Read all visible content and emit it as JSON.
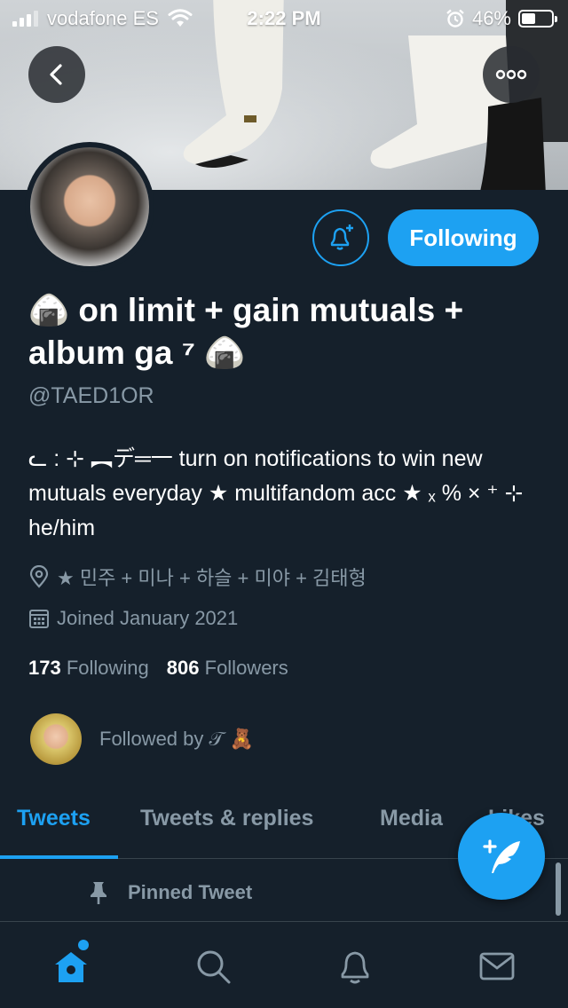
{
  "status_bar": {
    "carrier": "vodafone ES",
    "time": "2:22 PM",
    "battery_percent": "46%",
    "battery_level": 0.46
  },
  "header": {
    "back_icon": "chevron-left-icon",
    "more_icon": "more-horizontal-icon"
  },
  "profile": {
    "display_name": "🍙 on limit + gain mutuals + album ga ⁷ 🍙",
    "handle": "@TAED1OR",
    "bio": "ᓚ : ⊹ ︻デ═一 turn on notifications to win new mutuals everyday ★ multifandom acc ★ ₓ % × ⁺ ⊹ he/him",
    "location": "★ 민주 + 미나 + 하슬 + 미야 + 김태형",
    "joined": "Joined January 2021",
    "following_count": "173",
    "following_label": "Following",
    "followers_count": "806",
    "followers_label": "Followers",
    "followed_by": "Followed by 𝒯 🧸",
    "following_button": "Following"
  },
  "tabs": [
    {
      "label": "Tweets",
      "active": true
    },
    {
      "label": "Tweets & replies",
      "active": false
    },
    {
      "label": "Media",
      "active": false
    },
    {
      "label": "Likes",
      "active": false
    }
  ],
  "timeline": {
    "pinned_label": "Pinned Tweet"
  },
  "bottom_nav": {
    "items": [
      "home-icon",
      "search-icon",
      "bell-icon",
      "mail-icon"
    ]
  },
  "colors": {
    "background": "#15202b",
    "accent": "#1da1f2",
    "secondary_text": "#8899a6",
    "divider": "#38444d"
  }
}
